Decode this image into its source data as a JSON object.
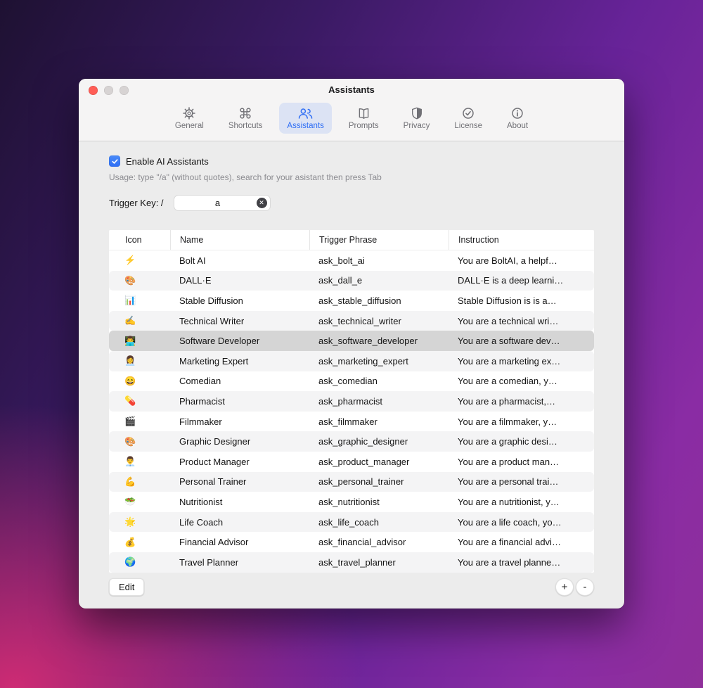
{
  "window": {
    "title": "Assistants"
  },
  "toolbar": {
    "tabs": [
      {
        "label": "General",
        "icon": "gear",
        "selected": false
      },
      {
        "label": "Shortcuts",
        "icon": "command",
        "selected": false
      },
      {
        "label": "Assistants",
        "icon": "people",
        "selected": true
      },
      {
        "label": "Prompts",
        "icon": "book",
        "selected": false
      },
      {
        "label": "Privacy",
        "icon": "shield",
        "selected": false
      },
      {
        "label": "License",
        "icon": "seal-check",
        "selected": false
      },
      {
        "label": "About",
        "icon": "info",
        "selected": false
      }
    ]
  },
  "content": {
    "enable_label": "Enable AI Assistants",
    "enable_checked": true,
    "usage_text": "Usage: type \"/a\" (without quotes), search for your asistant then press Tab",
    "trigger_label": "Trigger Key: /",
    "trigger_value": "a",
    "clear_icon": "✕",
    "table": {
      "headers": [
        "Icon",
        "Name",
        "Trigger Phrase",
        "Instruction"
      ],
      "rows": [
        {
          "icon": "⚡",
          "name": "Bolt AI",
          "trigger": "ask_bolt_ai",
          "instruction": "You are BoltAI, a helpf…",
          "selected": false
        },
        {
          "icon": "🎨",
          "name": "DALL·E",
          "trigger": "ask_dall_e",
          "instruction": "DALL·E is a deep learni…",
          "selected": false
        },
        {
          "icon": "📊",
          "name": "Stable Diffusion",
          "trigger": "ask_stable_diffusion",
          "instruction": "Stable Diffusion is is a…",
          "selected": false
        },
        {
          "icon": "✍️",
          "name": "Technical Writer",
          "trigger": "ask_technical_writer",
          "instruction": "You are a technical wri…",
          "selected": false
        },
        {
          "icon": "👨‍💻",
          "name": "Software Developer",
          "trigger": "ask_software_developer",
          "instruction": "You are a software dev…",
          "selected": true
        },
        {
          "icon": "👩‍💼",
          "name": "Marketing Expert",
          "trigger": "ask_marketing_expert",
          "instruction": "You are a marketing ex…",
          "selected": false
        },
        {
          "icon": "😄",
          "name": "Comedian",
          "trigger": "ask_comedian",
          "instruction": "You are a comedian, y…",
          "selected": false
        },
        {
          "icon": "💊",
          "name": "Pharmacist",
          "trigger": "ask_pharmacist",
          "instruction": "You are a pharmacist,…",
          "selected": false
        },
        {
          "icon": "🎬",
          "name": "Filmmaker",
          "trigger": "ask_filmmaker",
          "instruction": "You are a filmmaker, y…",
          "selected": false
        },
        {
          "icon": "🎨",
          "name": "Graphic Designer",
          "trigger": "ask_graphic_designer",
          "instruction": "You are a graphic desi…",
          "selected": false
        },
        {
          "icon": "👨‍💼",
          "name": "Product Manager",
          "trigger": "ask_product_manager",
          "instruction": "You are a product man…",
          "selected": false
        },
        {
          "icon": "💪",
          "name": "Personal Trainer",
          "trigger": "ask_personal_trainer",
          "instruction": "You are a personal trai…",
          "selected": false
        },
        {
          "icon": "🥗",
          "name": "Nutritionist",
          "trigger": "ask_nutritionist",
          "instruction": "You are a nutritionist, y…",
          "selected": false
        },
        {
          "icon": "🌟",
          "name": "Life Coach",
          "trigger": "ask_life_coach",
          "instruction": "You are a life coach, yo…",
          "selected": false
        },
        {
          "icon": "💰",
          "name": "Financial Advisor",
          "trigger": "ask_financial_advisor",
          "instruction": "You are a financial advi…",
          "selected": false
        },
        {
          "icon": "🌍",
          "name": "Travel Planner",
          "trigger": "ask_travel_planner",
          "instruction": "You are a travel planne…",
          "selected": false
        }
      ]
    }
  },
  "footer": {
    "edit_label": "Edit",
    "add_label": "+",
    "remove_label": "-"
  },
  "colors": {
    "accent": "#2E6EF5",
    "selected_row": "#D5D5D5",
    "checkbox_blue": "#2E6EF5",
    "selected_tab_bg": "#E1E9FA"
  }
}
